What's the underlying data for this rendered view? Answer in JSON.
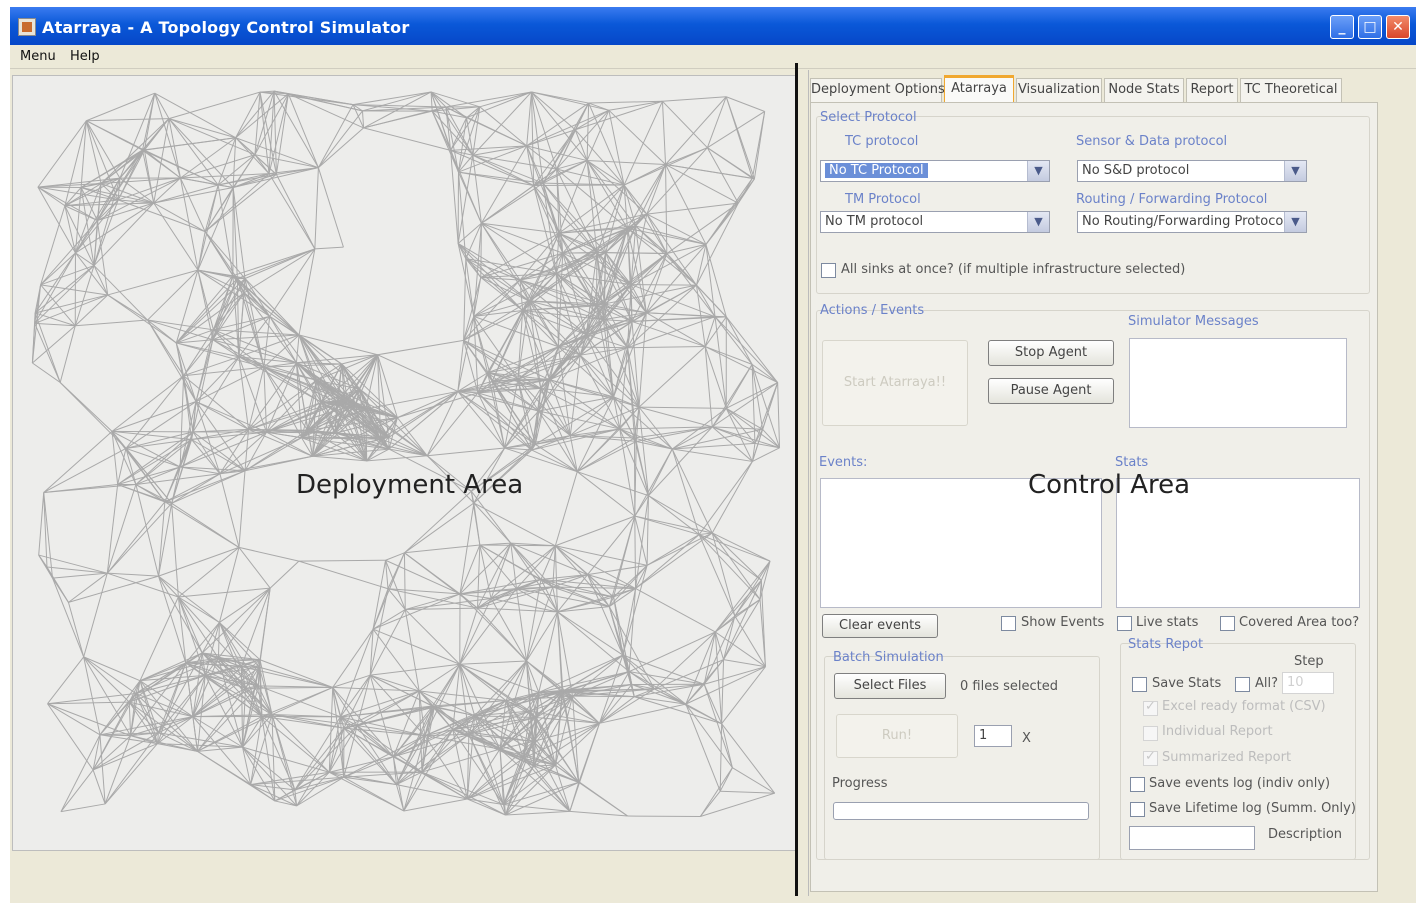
{
  "window": {
    "title": "Atarraya - A Topology Control Simulator",
    "controls": {
      "minimize": "_",
      "maximize": "□",
      "close": "✕"
    }
  },
  "menu": [
    "Menu",
    "Help"
  ],
  "overlay": {
    "deployment_label": "Deployment Area",
    "control_label": "Control Area"
  },
  "tabs": [
    "Deployment Options",
    "Atarraya",
    "Visualization",
    "Node Stats",
    "Report",
    "TC Theoretical"
  ],
  "select_protocol": {
    "title": "Select Protocol",
    "tc_label": "TC protocol",
    "tc_value": "No TC Protocol",
    "sd_label": "Sensor & Data protocol",
    "sd_value": "No S&D protocol",
    "tm_label": "TM Protocol",
    "tm_value": "No TM protocol",
    "routing_label": "Routing / Forwarding Protocol",
    "routing_value": "No Routing/Forwarding Protocol",
    "all_sinks_label": "All sinks at once? (if multiple infrastructure selected)"
  },
  "actions": {
    "title": "Actions / Events",
    "start_label": "Start Atarraya!!",
    "stop_label": "Stop Agent",
    "pause_label": "Pause Agent",
    "messages_label": "Simulator Messages"
  },
  "events": {
    "events_label": "Events:",
    "stats_label": "Stats",
    "clear_label": "Clear events",
    "show_events_label": "Show Events",
    "live_stats_label": "Live stats",
    "covered_area_label": "Covered Area too?"
  },
  "batch": {
    "title": "Batch Simulation",
    "select_files_label": "Select Files",
    "files_selected": "0 files selected",
    "run_label": "Run!",
    "repeat_value": "1",
    "times_label": "X",
    "progress_label": "Progress",
    "progress_value": 0
  },
  "stats_report": {
    "title": "Stats Repot",
    "step_label": "Step",
    "save_stats_label": "Save Stats",
    "all_label": "All?",
    "step_value": "10",
    "excel_label": "Excel ready format (CSV)",
    "individual_label": "Individual Report",
    "summarized_label": "Summarized Report",
    "events_log_label": "Save events log (indiv only)",
    "lifetime_log_label": "Save Lifetime log (Summ. Only)",
    "description_label": "Description"
  }
}
